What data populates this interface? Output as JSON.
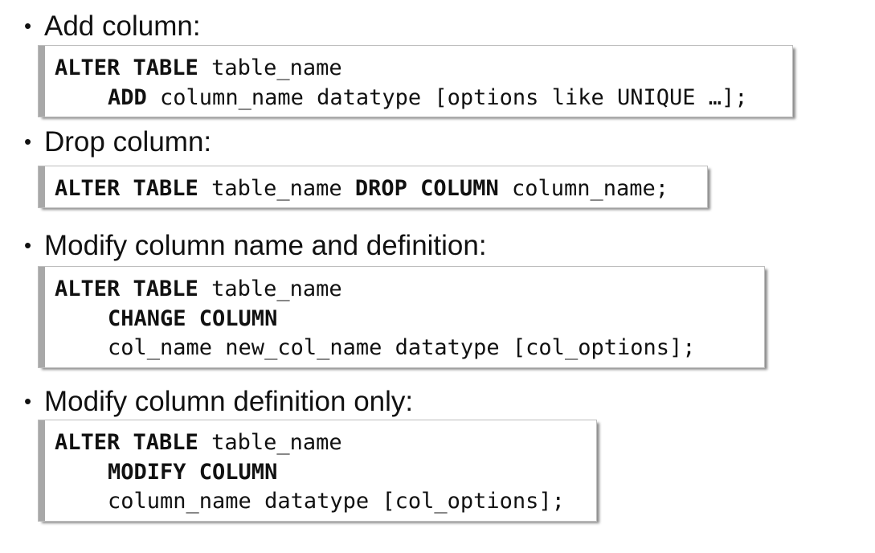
{
  "sections": [
    {
      "heading": "Add column:",
      "code": {
        "line1": {
          "kw1": "ALTER TABLE",
          "rest": " table_name"
        },
        "line2": {
          "kw1": "ADD",
          "rest": " column_name datatype [options like UNIQUE …];"
        }
      }
    },
    {
      "heading": "Drop column:",
      "code": {
        "line1": {
          "kw1": "ALTER TABLE",
          "mid": " table_name ",
          "kw2": "DROP COLUMN",
          "rest": " column_name;"
        }
      }
    },
    {
      "heading": "Modify column name and definition:",
      "code": {
        "line1": {
          "kw1": "ALTER TABLE",
          "rest": " table_name"
        },
        "line2": {
          "kw1": "CHANGE COLUMN"
        },
        "line3": {
          "text": "col_name new_col_name datatype [col_options];"
        }
      }
    },
    {
      "heading": "Modify column definition only:",
      "code": {
        "line1": {
          "kw1": "ALTER TABLE",
          "rest": " table_name"
        },
        "line2": {
          "kw1": "MODIFY COLUMN"
        },
        "line3": {
          "text": "column_name datatype [col_options];"
        }
      }
    }
  ],
  "bullet_symbol": "•"
}
